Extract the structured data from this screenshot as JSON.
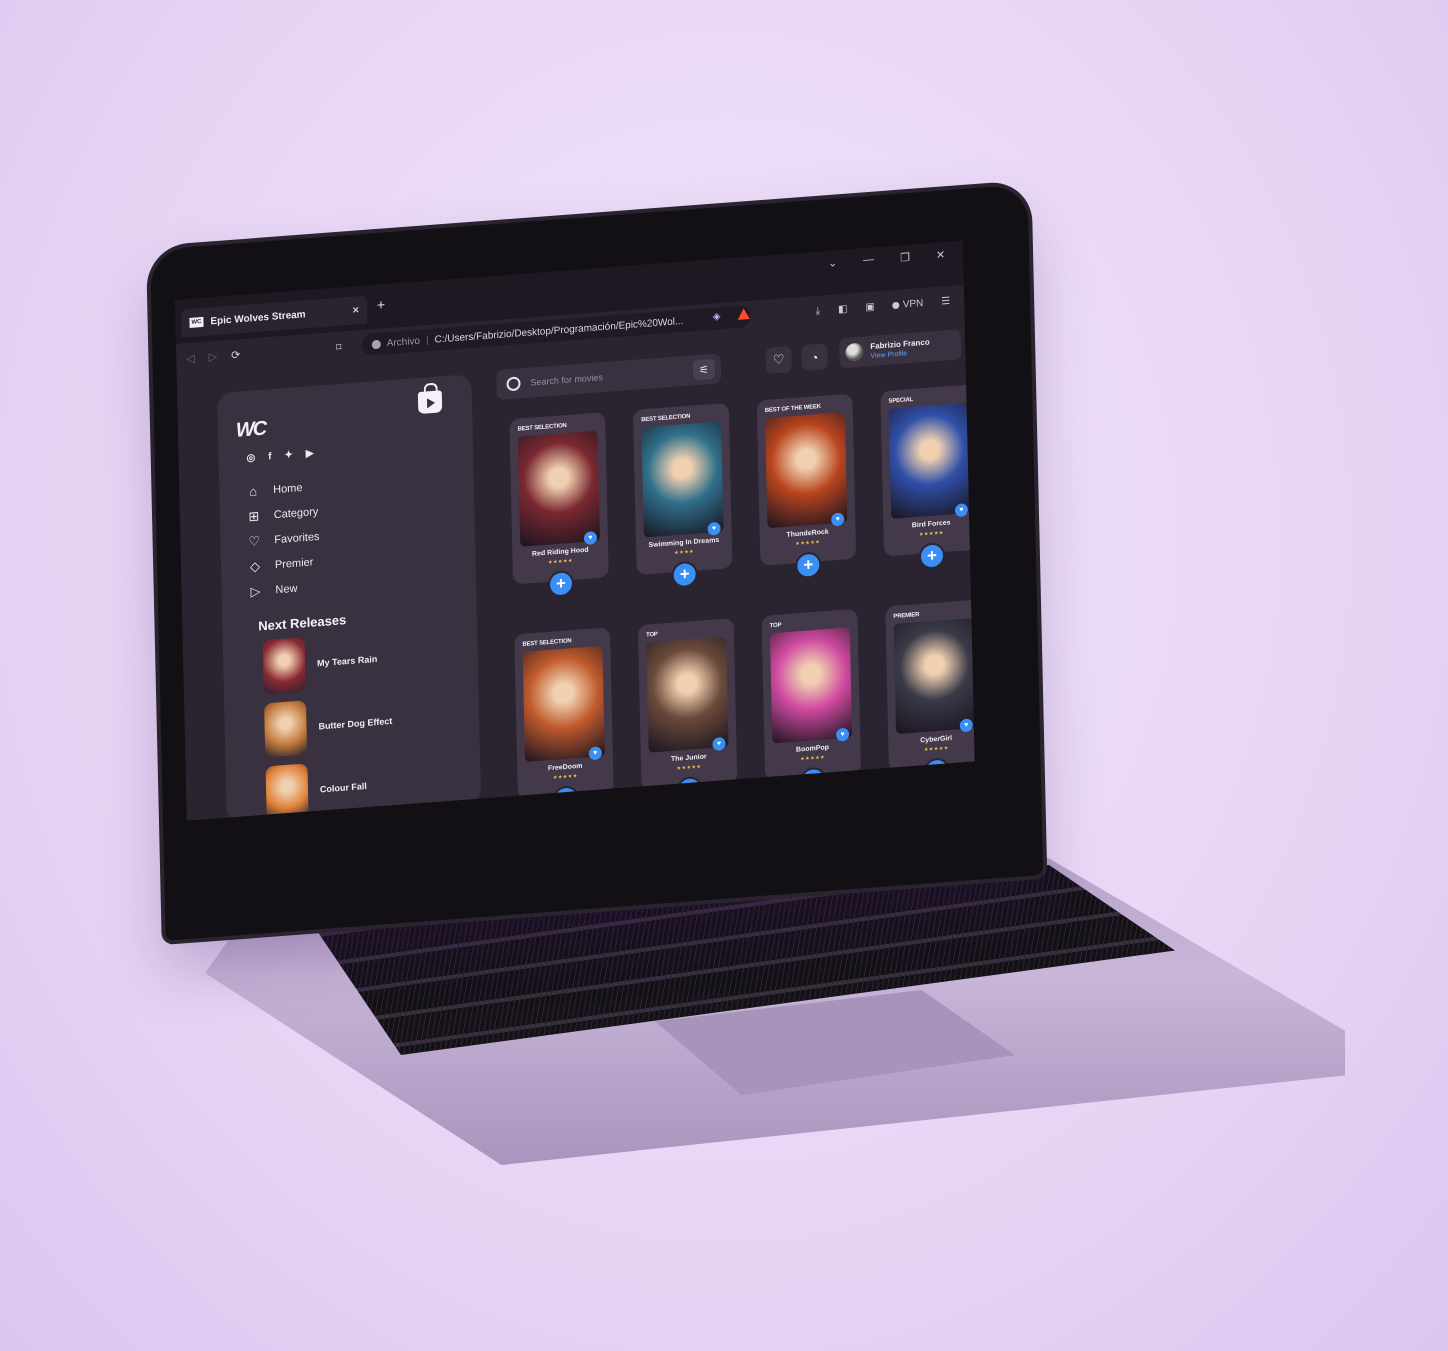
{
  "browser": {
    "tab_title": "Epic Wolves Stream",
    "tab_logo": "WC",
    "tab_close": "×",
    "new_tab": "+",
    "address_label": "Archivo",
    "address_url": "C:/Users/Fabrizio/Desktop/Programación/Epic%20Wol...",
    "vpn_label": "VPN"
  },
  "brand": {
    "logo": "WC"
  },
  "menu": [
    {
      "label": "Home",
      "icon": "home-icon"
    },
    {
      "label": "Category",
      "icon": "category-icon"
    },
    {
      "label": "Favorites",
      "icon": "heart-icon"
    },
    {
      "label": "Premier",
      "icon": "diamond-icon"
    },
    {
      "label": "New",
      "icon": "play-icon"
    }
  ],
  "next_releases": {
    "title": "Next Releases",
    "items": [
      {
        "name": "My Tears Rain",
        "color": "#8a2a34"
      },
      {
        "name": "Butter Dog Effect",
        "color": "#c07a3a"
      },
      {
        "name": "Colour Fall",
        "color": "#e0823a"
      }
    ]
  },
  "search": {
    "placeholder": "Search for movies"
  },
  "profile": {
    "name": "Fabrizio Franco",
    "link": "View Profile"
  },
  "movies": [
    {
      "tag": "BEST SELECTION",
      "title": "Red Riding Hood",
      "stars": "★★★★★",
      "color": "#7a2830"
    },
    {
      "tag": "BEST SELECTION",
      "title": "Swimming In Dreams",
      "stars": "★★★★",
      "color": "#2f6f8a"
    },
    {
      "tag": "BEST OF THE WEEK",
      "title": "ThundeRock",
      "stars": "★★★★★",
      "color": "#b8441e"
    },
    {
      "tag": "SPECIAL",
      "title": "Bird Forces",
      "stars": "★★★★★",
      "color": "#2f4fa8"
    },
    {
      "tag": "BEST SELECTION",
      "title": "FreeDoom",
      "stars": "★★★★★",
      "color": "#c05a2c"
    },
    {
      "tag": "TOP",
      "title": "The Junior",
      "stars": "★★★★★",
      "color": "#6a4a3a"
    },
    {
      "tag": "TOP",
      "title": "BoomPop",
      "stars": "★★★★★",
      "color": "#d04aa0"
    },
    {
      "tag": "PREMIER",
      "title": "CyberGirl",
      "stars": "★★★★★",
      "color": "#3a3a48"
    }
  ],
  "colors": {
    "accent": "#3a8ff5",
    "panel": "#3a3140",
    "background": "#2a2330"
  }
}
